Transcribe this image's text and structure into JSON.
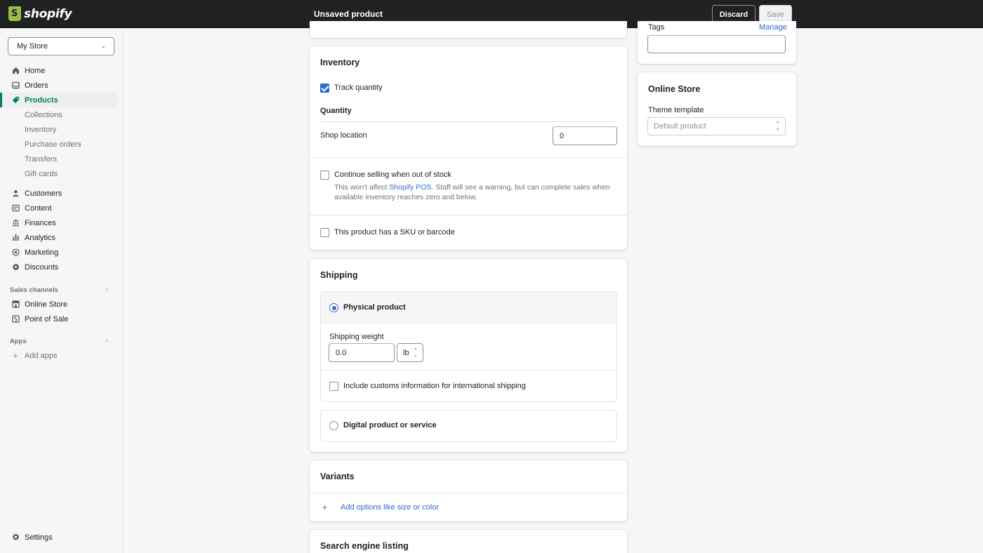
{
  "topbar": {
    "logo_text": "shopify",
    "page_status": "Unsaved product",
    "discard_label": "Discard",
    "save_label": "Save"
  },
  "sidebar": {
    "store_name": "My Store",
    "nav": [
      {
        "label": "Home",
        "icon": "home-icon"
      },
      {
        "label": "Orders",
        "icon": "inbox-icon"
      },
      {
        "label": "Products",
        "icon": "tag-icon",
        "active": true
      }
    ],
    "product_sub": [
      "Collections",
      "Inventory",
      "Purchase orders",
      "Transfers",
      "Gift cards"
    ],
    "nav2": [
      {
        "label": "Customers",
        "icon": "person-icon"
      },
      {
        "label": "Content",
        "icon": "content-icon"
      },
      {
        "label": "Finances",
        "icon": "bank-icon"
      },
      {
        "label": "Analytics",
        "icon": "bar-chart-icon"
      },
      {
        "label": "Marketing",
        "icon": "target-icon"
      },
      {
        "label": "Discounts",
        "icon": "discount-icon"
      }
    ],
    "sales_channels_label": "Sales channels",
    "sales_channels": [
      {
        "label": "Online Store",
        "icon": "store-icon"
      },
      {
        "label": "Point of Sale",
        "icon": "pos-icon"
      }
    ],
    "apps_label": "Apps",
    "add_apps_label": "Add apps",
    "settings_label": "Settings"
  },
  "inventory": {
    "title": "Inventory",
    "track_quantity_label": "Track quantity",
    "track_quantity_checked": true,
    "quantity_heading": "Quantity",
    "location_label": "Shop location",
    "location_quantity": "0",
    "continue_selling_label": "Continue selling when out of stock",
    "continue_selling_checked": false,
    "help_prefix": "This won't affect ",
    "help_link": "Shopify POS",
    "help_suffix": ". Staff will see a warning, but can complete sales when",
    "help_line2": "available inventory reaches zero and below.",
    "sku_label": "This product has a SKU or barcode",
    "sku_checked": false
  },
  "shipping": {
    "title": "Shipping",
    "physical_label": "Physical product",
    "physical_selected": true,
    "weight_label": "Shipping weight",
    "weight_value": "0.0",
    "weight_unit": "lb",
    "customs_label": "Include customs information for international shipping",
    "customs_checked": false,
    "digital_label": "Digital product or service",
    "digital_selected": false
  },
  "variants": {
    "title": "Variants",
    "add_options_label": "Add options like size or color",
    "plus_glyph": "+"
  },
  "seo": {
    "title": "Search engine listing"
  },
  "tags": {
    "label": "Tags",
    "manage_label": "Manage",
    "value": ""
  },
  "online_store": {
    "title": "Online Store",
    "theme_template_label": "Theme template",
    "theme_template_value": "Default product"
  },
  "colors": {
    "topbar": "#202123",
    "accent_green": "#008060",
    "link_blue": "#2c6ecb"
  }
}
